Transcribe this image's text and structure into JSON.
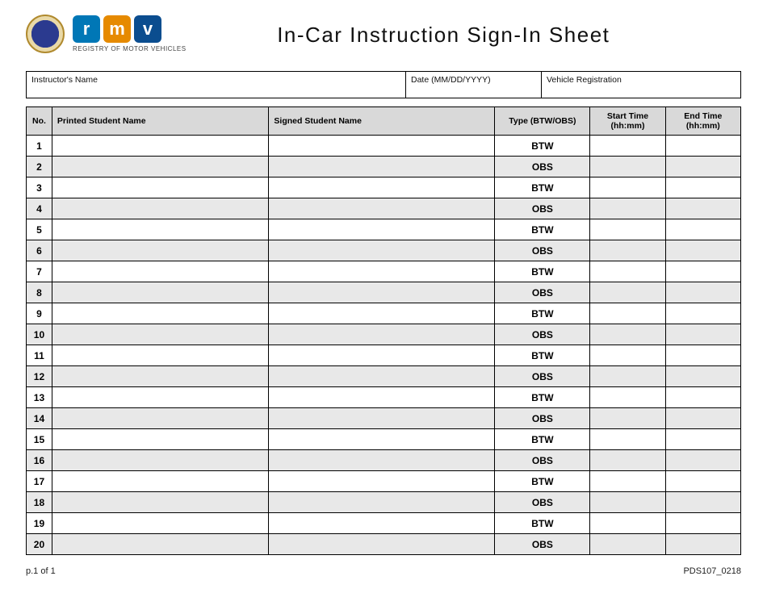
{
  "header": {
    "agency_sub": "REGISTRY OF MOTOR VEHICLES",
    "tiles": [
      "r",
      "m",
      "v"
    ],
    "title": "In-Car Instruction Sign-In Sheet"
  },
  "top_fields": {
    "instructor_label": "Instructor's Name",
    "date_label": "Date (MM/DD/YYYY)",
    "vehicle_label": "Vehicle Registration"
  },
  "table": {
    "headers": {
      "no": "No.",
      "printed": "Printed Student Name",
      "signed": "Signed Student Name",
      "type": "Type (BTW/OBS)",
      "start": "Start Time (hh:mm)",
      "end": "End Time (hh:mm)"
    },
    "rows": [
      {
        "no": "1",
        "type": "BTW"
      },
      {
        "no": "2",
        "type": "OBS"
      },
      {
        "no": "3",
        "type": "BTW"
      },
      {
        "no": "4",
        "type": "OBS"
      },
      {
        "no": "5",
        "type": "BTW"
      },
      {
        "no": "6",
        "type": "OBS"
      },
      {
        "no": "7",
        "type": "BTW"
      },
      {
        "no": "8",
        "type": "OBS"
      },
      {
        "no": "9",
        "type": "BTW"
      },
      {
        "no": "10",
        "type": "OBS"
      },
      {
        "no": "11",
        "type": "BTW"
      },
      {
        "no": "12",
        "type": "OBS"
      },
      {
        "no": "13",
        "type": "BTW"
      },
      {
        "no": "14",
        "type": "OBS"
      },
      {
        "no": "15",
        "type": "BTW"
      },
      {
        "no": "16",
        "type": "OBS"
      },
      {
        "no": "17",
        "type": "BTW"
      },
      {
        "no": "18",
        "type": "OBS"
      },
      {
        "no": "19",
        "type": "BTW"
      },
      {
        "no": "20",
        "type": "OBS"
      }
    ]
  },
  "footer": {
    "page": "p.1 of 1",
    "form_id": "PDS107_0218"
  }
}
